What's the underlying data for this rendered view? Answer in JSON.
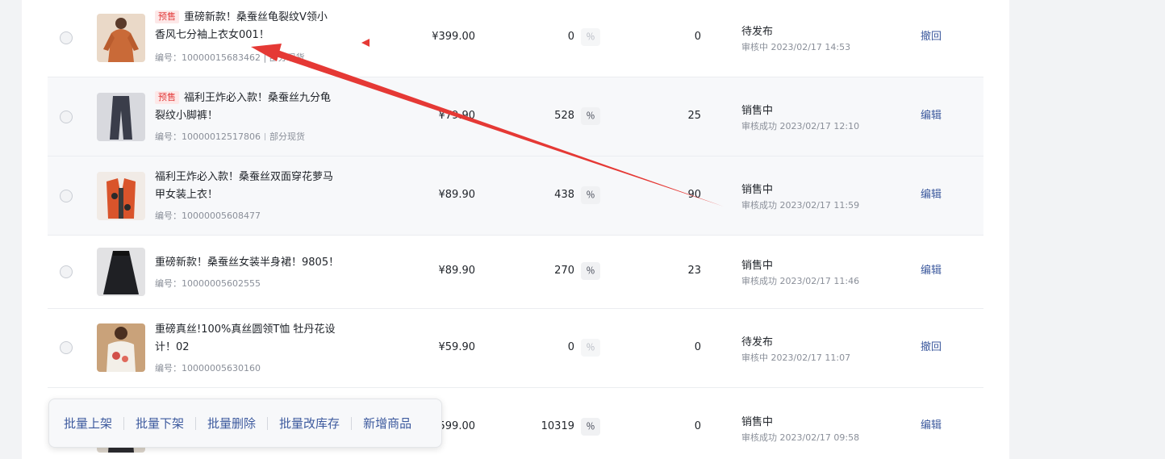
{
  "products": [
    {
      "presale_tag": "预售",
      "title_line1": "重磅新款！桑蚕丝龟裂纹V领小",
      "title_line2": "香风七分袖上衣女001！",
      "meta": "编号：10000015683462 | 部分现货",
      "price": "¥399.00",
      "stock": "0",
      "pct_icon": "％",
      "sales": "0",
      "status": "待发布",
      "audit": "审核中 2023/02/17 14:53",
      "action": "撤回",
      "thumb_color": "#c96a38",
      "icon": "product-thumbnail-icon"
    },
    {
      "presale_tag": "预售",
      "title_line1": "福利王炸必入款！桑蚕丝九分龟",
      "title_line2": "裂纹小脚裤！",
      "meta_id": "编号：10000012517806",
      "meta_stock": "部分现货",
      "price": "¥79.90",
      "stock": "528",
      "pct_icon": "％",
      "sales": "25",
      "status": "销售中",
      "audit": "审核成功 2023/02/17 12:10",
      "action": "编辑",
      "thumb_color": "#3a3d4a"
    },
    {
      "title_line1": "福利王炸必入款！桑蚕丝双面穿花萝马",
      "title_line2": "甲女装上衣！",
      "meta_id": "编号：10000005608477",
      "price": "¥89.90",
      "stock": "438",
      "pct_icon": "％",
      "sales": "90",
      "status": "销售中",
      "audit": "审核成功 2023/02/17 11:59",
      "action": "编辑",
      "thumb_color": "#d9542b"
    },
    {
      "title_line1": "重磅新款！桑蚕丝女装半身裙！9805！",
      "meta_id": "编号：10000005602555",
      "price": "¥89.90",
      "stock": "270",
      "pct_icon": "％",
      "sales": "23",
      "status": "销售中",
      "audit": "审核成功 2023/02/17 11:46",
      "action": "编辑",
      "thumb_color": "#1f2024"
    },
    {
      "title_line1": "重磅真丝!100%真丝圆领T恤 牡丹花设",
      "title_line2": "计！02",
      "meta_id": "编号：10000005630160",
      "price": "¥59.90",
      "stock": "0",
      "pct_icon": "％",
      "sales": "0",
      "status": "待发布",
      "audit": "审核中 2023/02/17 11:07",
      "action": "撤回",
      "thumb_color": "#e9e4dc"
    },
    {
      "price": "¥599.00",
      "stock": "10319",
      "pct_icon": "％",
      "sales": "0",
      "status": "销售中",
      "audit": "审核成功 2023/02/17 09:58",
      "action": "编辑",
      "thumb_color": "#2a2a2e"
    }
  ],
  "batch_bar": {
    "on_shelf": "批量上架",
    "off_shelf": "批量下架",
    "delete": "批量删除",
    "edit_stock": "批量改库存",
    "add_product": "新增商品"
  },
  "annotation": {
    "arrow_color": "#e53935"
  }
}
